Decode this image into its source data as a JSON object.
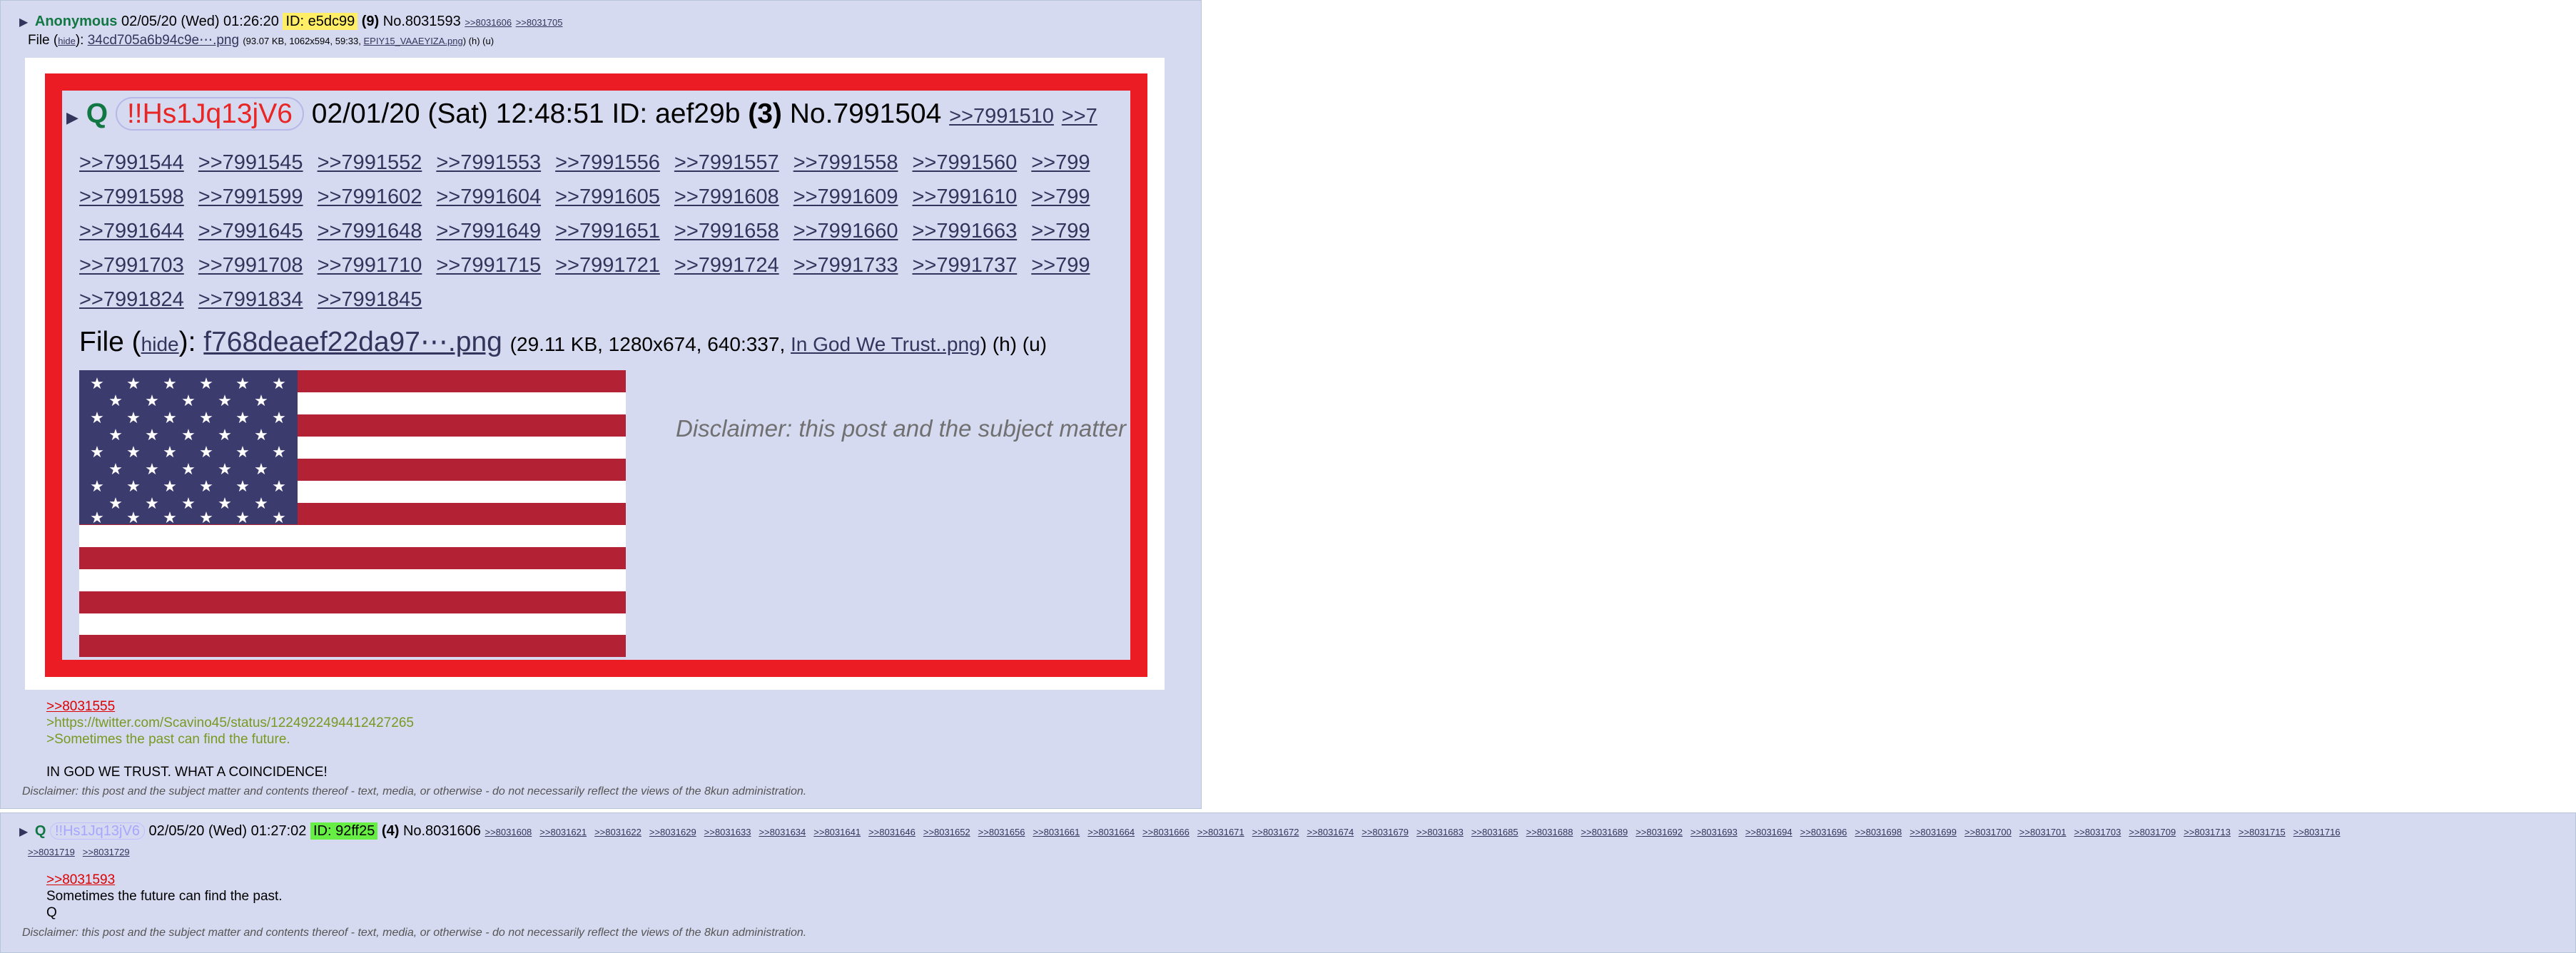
{
  "post1": {
    "name": "Anonymous",
    "date": "02/05/20 (Wed) 01:26:20",
    "id": "ID: e5dc99",
    "count": "(9)",
    "number": "No.8031593",
    "backlinks": [
      ">>8031606",
      ">>8031705"
    ],
    "file_label": "File (",
    "file_hide": "hide",
    "file_sep": "): ",
    "file_name": "34cd705a6b94c9e⋯.png",
    "file_meta": "(93.07 KB, 1062x594, 59:33, ",
    "file_orig": "EPIY15_VAAEYIZA.png",
    "file_tail": ") (h) (u)",
    "embedded": {
      "trip_letter": "Q",
      "tripcode": "!!Hs1Jq13jV6",
      "date": "02/01/20 (Sat) 12:48:51",
      "id": "ID: aef29b",
      "count": "(3)",
      "number": "No.7991504",
      "header_links": [
        ">>7991510",
        ">>7"
      ],
      "rows": [
        [
          ">>7991544",
          ">>7991545",
          ">>7991552",
          ">>7991553",
          ">>7991556",
          ">>7991557",
          ">>7991558",
          ">>7991560",
          ">>799"
        ],
        [
          ">>7991598",
          ">>7991599",
          ">>7991602",
          ">>7991604",
          ">>7991605",
          ">>7991608",
          ">>7991609",
          ">>7991610",
          ">>799"
        ],
        [
          ">>7991644",
          ">>7991645",
          ">>7991648",
          ">>7991649",
          ">>7991651",
          ">>7991658",
          ">>7991660",
          ">>7991663",
          ">>799"
        ],
        [
          ">>7991703",
          ">>7991708",
          ">>7991710",
          ">>7991715",
          ">>7991721",
          ">>7991724",
          ">>7991733",
          ">>7991737",
          ">>799"
        ],
        [
          ">>7991824",
          ">>7991834",
          ">>7991845"
        ]
      ],
      "file_label": "File (",
      "file_hide": "hide",
      "file_sep": "): ",
      "file_name": "f768deaef22da97⋯.png",
      "file_meta": "(29.11 KB, 1280x674, 640:337, ",
      "file_orig": "In God We Trust..png",
      "file_tail": ") (h) (u)",
      "disclaimer": "Disclaimer: this post and the subject matter"
    },
    "quote": ">>8031555",
    "lines": [
      ">https://twitter.com/Scavino45/status/1224922494412427265",
      ">Sometimes the past can find the future."
    ],
    "text": "IN GOD WE TRUST. WHAT A COINCIDENCE!",
    "disclaimer": "Disclaimer: this post and the subject matter and contents thereof - text, media, or otherwise - do not necessarily reflect the views of the 8kun administration."
  },
  "post2": {
    "trip_letter": "Q",
    "tripcode": "!!Hs1Jq13jV6",
    "date": "02/05/20 (Wed) 01:27:02",
    "id": "ID: 92ff25",
    "count": "(4)",
    "number": "No.8031606",
    "replies": [
      ">>8031608",
      ">>8031621",
      ">>8031622",
      ">>8031629",
      ">>8031633",
      ">>8031634",
      ">>8031641",
      ">>8031646",
      ">>8031652",
      ">>8031656",
      ">>8031661",
      ">>8031664",
      ">>8031666",
      ">>8031671",
      ">>8031672",
      ">>8031674",
      ">>8031679",
      ">>8031683",
      ">>8031685",
      ">>8031688",
      ">>8031689",
      ">>8031692",
      ">>8031693",
      ">>8031694",
      ">>8031696",
      ">>8031698",
      ">>8031699",
      ">>8031700",
      ">>8031701",
      ">>8031703",
      ">>8031709",
      ">>8031713",
      ">>8031715",
      ">>8031716"
    ],
    "replies_row2": [
      ">>8031719",
      ">>8031729"
    ],
    "quote": ">>8031593",
    "line1": "Sometimes the future can find the past.",
    "line2": "Q",
    "disclaimer": "Disclaimer: this post and the subject matter and contents thereof - text, media, or otherwise - do not necessarily reflect the views of the 8kun administration."
  }
}
